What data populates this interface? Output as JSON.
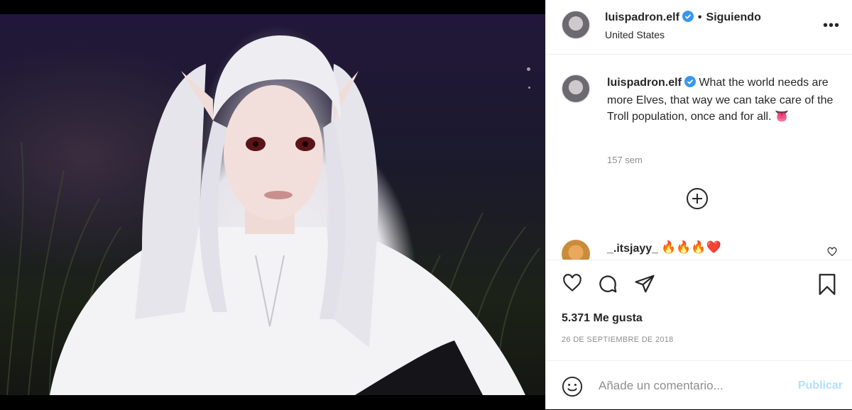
{
  "post": {
    "image_alt": "Photo of person with long white hair and elf ears wearing a white shirt at night",
    "header": {
      "username": "luispadron.elf",
      "follow_status": "Siguiendo",
      "location": "United States",
      "more_glyph": "•••"
    },
    "caption": {
      "username": "luispadron.elf",
      "text": "What the world needs are more Elves, that way we can take care of the Troll population, once and for all.",
      "emoji": "👅",
      "time": "157 sem"
    },
    "comments": [
      {
        "username": "_.itsjayy_",
        "text": "🔥🔥🔥❤️"
      }
    ],
    "likes": "5.371 Me gusta",
    "date": "26 DE SEPTIEMBRE DE 2018",
    "add_comment": {
      "placeholder": "Añade un comentario...",
      "publish_label": "Publicar"
    }
  },
  "colors": {
    "text": "#262626",
    "muted": "#8e8e8e",
    "verified": "#3897f0",
    "publish_disabled": "#b2dffc"
  },
  "icons": {
    "like": "heart-icon",
    "comment": "comment-bubble-icon",
    "share": "paper-plane-icon",
    "save": "bookmark-icon",
    "emoji": "smiley-icon",
    "load_more": "plus-circle-icon"
  }
}
